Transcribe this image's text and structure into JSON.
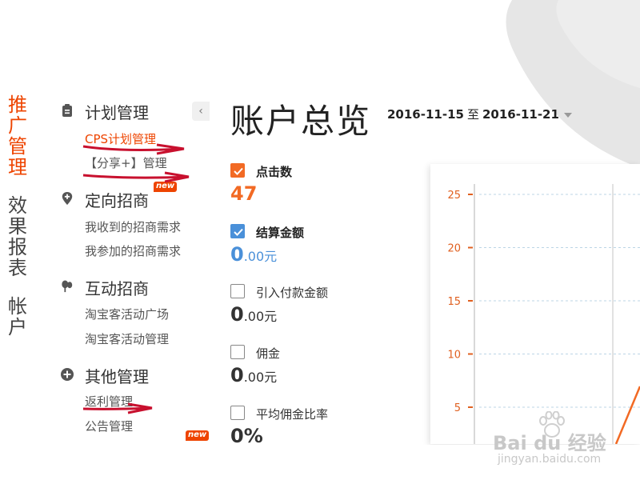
{
  "leftnav": {
    "groups": [
      {
        "label": "推广管理",
        "chars": [
          "推",
          "广",
          "管",
          "理"
        ],
        "active": true
      },
      {
        "label": "效果报表",
        "chars": [
          "效",
          "果",
          "报",
          "表"
        ],
        "active": false
      },
      {
        "label": "帐户",
        "chars": [
          "帐",
          "户"
        ],
        "active": false
      }
    ]
  },
  "subnav": {
    "sections": [
      {
        "title": "计划管理",
        "icon": "clipboard-icon",
        "items": [
          "CPS计划管理",
          "【分享+】管理"
        ]
      },
      {
        "title": "定向招商",
        "icon": "location-plus-icon",
        "badge": "new",
        "items": [
          "我收到的招商需求",
          "我参加的招商需求"
        ]
      },
      {
        "title": "互动招商",
        "icon": "chat-bubbles-icon",
        "items": [
          "淘宝客活动广场",
          "淘宝客活动管理"
        ]
      },
      {
        "title": "其他管理",
        "icon": "plus-circle-icon",
        "items": [
          "返利管理",
          "公告管理"
        ],
        "item_badge": "new"
      }
    ],
    "collapse_icon": "chevron-left-icon"
  },
  "main": {
    "title": "账户总览",
    "date_start": "2016-11-15",
    "date_sep": "至",
    "date_end": "2016-11-21"
  },
  "metrics": [
    {
      "label": "点击数",
      "checked": true,
      "color": "#f26a24",
      "value_big": "47",
      "value_small": ""
    },
    {
      "label": "结算金额",
      "checked": true,
      "color": "#4a90d9",
      "value_big": "0",
      "value_small": ".00元"
    },
    {
      "label": "引入付款金额",
      "checked": false,
      "value_big": "0",
      "value_small": ".00元"
    },
    {
      "label": "佣金",
      "checked": false,
      "value_big": "0",
      "value_small": ".00元"
    },
    {
      "label": "平均佣金比率",
      "checked": false,
      "value_big": "0%",
      "value_small": ""
    }
  ],
  "chart_data": {
    "type": "line",
    "y_ticks": [
      "25",
      "20",
      "15",
      "10",
      "5"
    ],
    "ylim": [
      0,
      25
    ],
    "grid": true,
    "series": [
      {
        "color": "#f26a24"
      }
    ]
  },
  "watermark": {
    "brand": "Bai du 经验",
    "url": "jingyan.baidu.com"
  },
  "colors": {
    "accent": "#ee4400",
    "orange": "#f26a24",
    "blue": "#4a90d9"
  }
}
